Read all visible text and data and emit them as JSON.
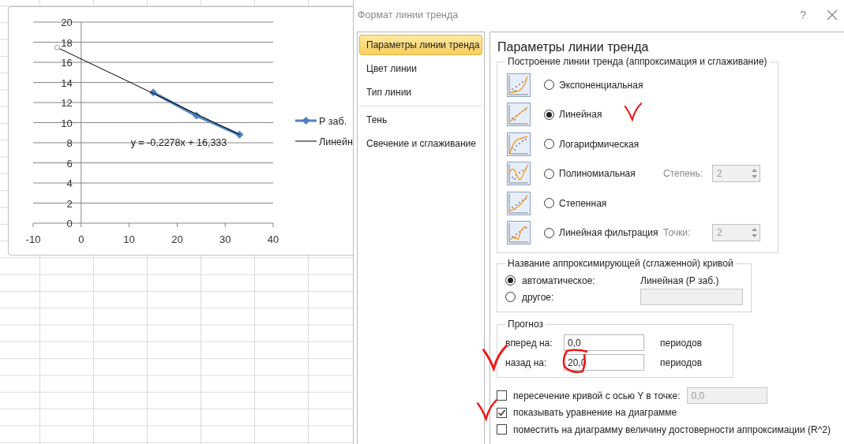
{
  "chart": {
    "chart_data": {
      "type": "line",
      "x": [
        -5,
        15,
        24,
        33
      ],
      "series": [
        {
          "name": "Р заб.",
          "color": "#4f81bd",
          "marker": "diamond",
          "values": [
            null,
            13,
            10.7,
            8.8
          ]
        },
        {
          "name": "Линейн",
          "color": "#000000",
          "values": [
            17.47,
            null,
            null,
            8.81
          ]
        }
      ],
      "xlim": [
        -10,
        40
      ],
      "ylim": [
        0,
        20
      ],
      "xticks": [
        -10,
        0,
        10,
        20,
        30,
        40
      ],
      "yticks": [
        0,
        2,
        4,
        6,
        8,
        10,
        12,
        14,
        16,
        18,
        20
      ],
      "grid": true,
      "legend": true,
      "annotations": [
        "y = -0,2278x + 16,333"
      ]
    }
  },
  "dialog": {
    "title": "Формат линии тренда",
    "help": "?",
    "sidebar": [
      {
        "items": [
          {
            "label": "Параметры линии тренда",
            "selected": true
          },
          {
            "label": "Цвет линии",
            "selected": false
          },
          {
            "label": "Тип линии",
            "selected": false
          }
        ]
      },
      {
        "items": [
          {
            "label": "Тень",
            "selected": false
          },
          {
            "label": "Свечение и сглаживание",
            "selected": false
          }
        ]
      }
    ],
    "heading": "Параметры линии тренда",
    "trend_type": {
      "legend": "Построение линии тренда (аппроксимация и сглаживание)",
      "options": [
        {
          "kind": "exponential",
          "label": "Экспоненциальная",
          "selected": false,
          "marked": false
        },
        {
          "kind": "linear",
          "label": "Линейная",
          "selected": true,
          "marked": true
        },
        {
          "kind": "logarithmic",
          "label": "Логарифмическая",
          "selected": false,
          "marked": false
        },
        {
          "kind": "polynomial",
          "label": "Полиномиальная",
          "selected": false,
          "marked": false,
          "param": {
            "label": "Степень:",
            "value": "2",
            "disabled": true
          }
        },
        {
          "kind": "power",
          "label": "Степенная",
          "selected": false,
          "marked": false
        },
        {
          "kind": "moving_average",
          "label": "Линейная фильтрация",
          "selected": false,
          "marked": false,
          "param": {
            "label": "Точки:",
            "value": "2",
            "disabled": true
          }
        }
      ]
    },
    "curve_name": {
      "legend": "Название аппроксимирующей (сглаженной) кривой",
      "options": [
        {
          "label": "автоматическое:",
          "selected": true,
          "value": "Линейная (Р заб.)"
        },
        {
          "label": "другое:",
          "selected": false,
          "field": {
            "disabled": true
          }
        }
      ]
    },
    "forecast": {
      "legend": "Прогноз",
      "rows": [
        {
          "label": "вперед на:",
          "value": "0,0",
          "unit": "периодов",
          "marked": false,
          "circled": false
        },
        {
          "label": "назад на:",
          "value": "20,0",
          "unit": "периодов",
          "marked": true,
          "circled": true
        }
      ]
    },
    "checks": [
      {
        "label": "пересечение кривой с осью Y в точке:",
        "checked": false,
        "marked": false,
        "field": {
          "value": "0,0",
          "disabled": true
        }
      },
      {
        "label": "показывать уравнение на диаграмме",
        "checked": true,
        "marked": true
      },
      {
        "label": "поместить на диаграмму величину достоверности аппроксимации (R^2)",
        "checked": false,
        "marked": false
      }
    ]
  }
}
